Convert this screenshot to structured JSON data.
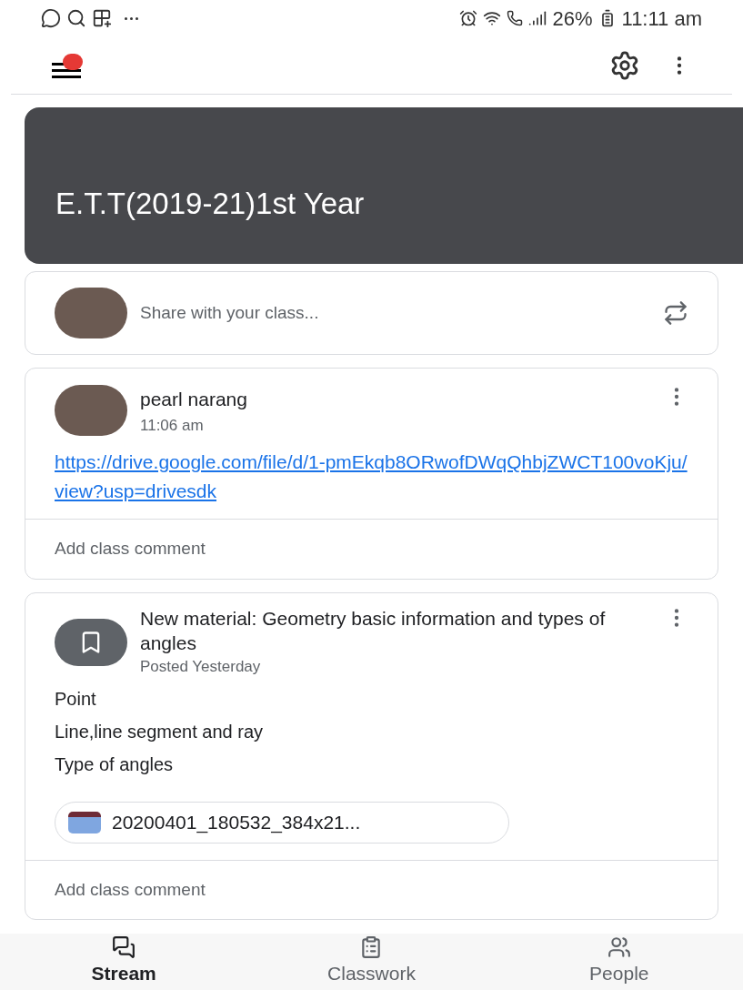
{
  "status_bar": {
    "battery": "26%",
    "time": "11:11 am"
  },
  "class_header": {
    "title": "E.T.T(2019-21)1st Year"
  },
  "share_box": {
    "placeholder": "Share with your class..."
  },
  "posts": [
    {
      "kind": "announcement",
      "author": "pearl narang",
      "time": "11:06 am",
      "link": "https://drive.google.com/file/d/1-pmEkqb8ORwofDWqQhbjZWCT100voKju/view?usp=drivesdk",
      "comment_placeholder": "Add class comment"
    },
    {
      "kind": "material",
      "title": "New material: Geometry basic information and types of angles",
      "time": "Posted Yesterday",
      "lines": [
        "Point",
        "Line,line segment  and ray",
        "Type of angles"
      ],
      "attachment": "20200401_180532_384x21...",
      "comment_placeholder": "Add class comment"
    }
  ],
  "bottom_nav": [
    {
      "label": "Stream",
      "selected": true
    },
    {
      "label": "Classwork",
      "selected": false
    },
    {
      "label": "People",
      "selected": false
    }
  ]
}
